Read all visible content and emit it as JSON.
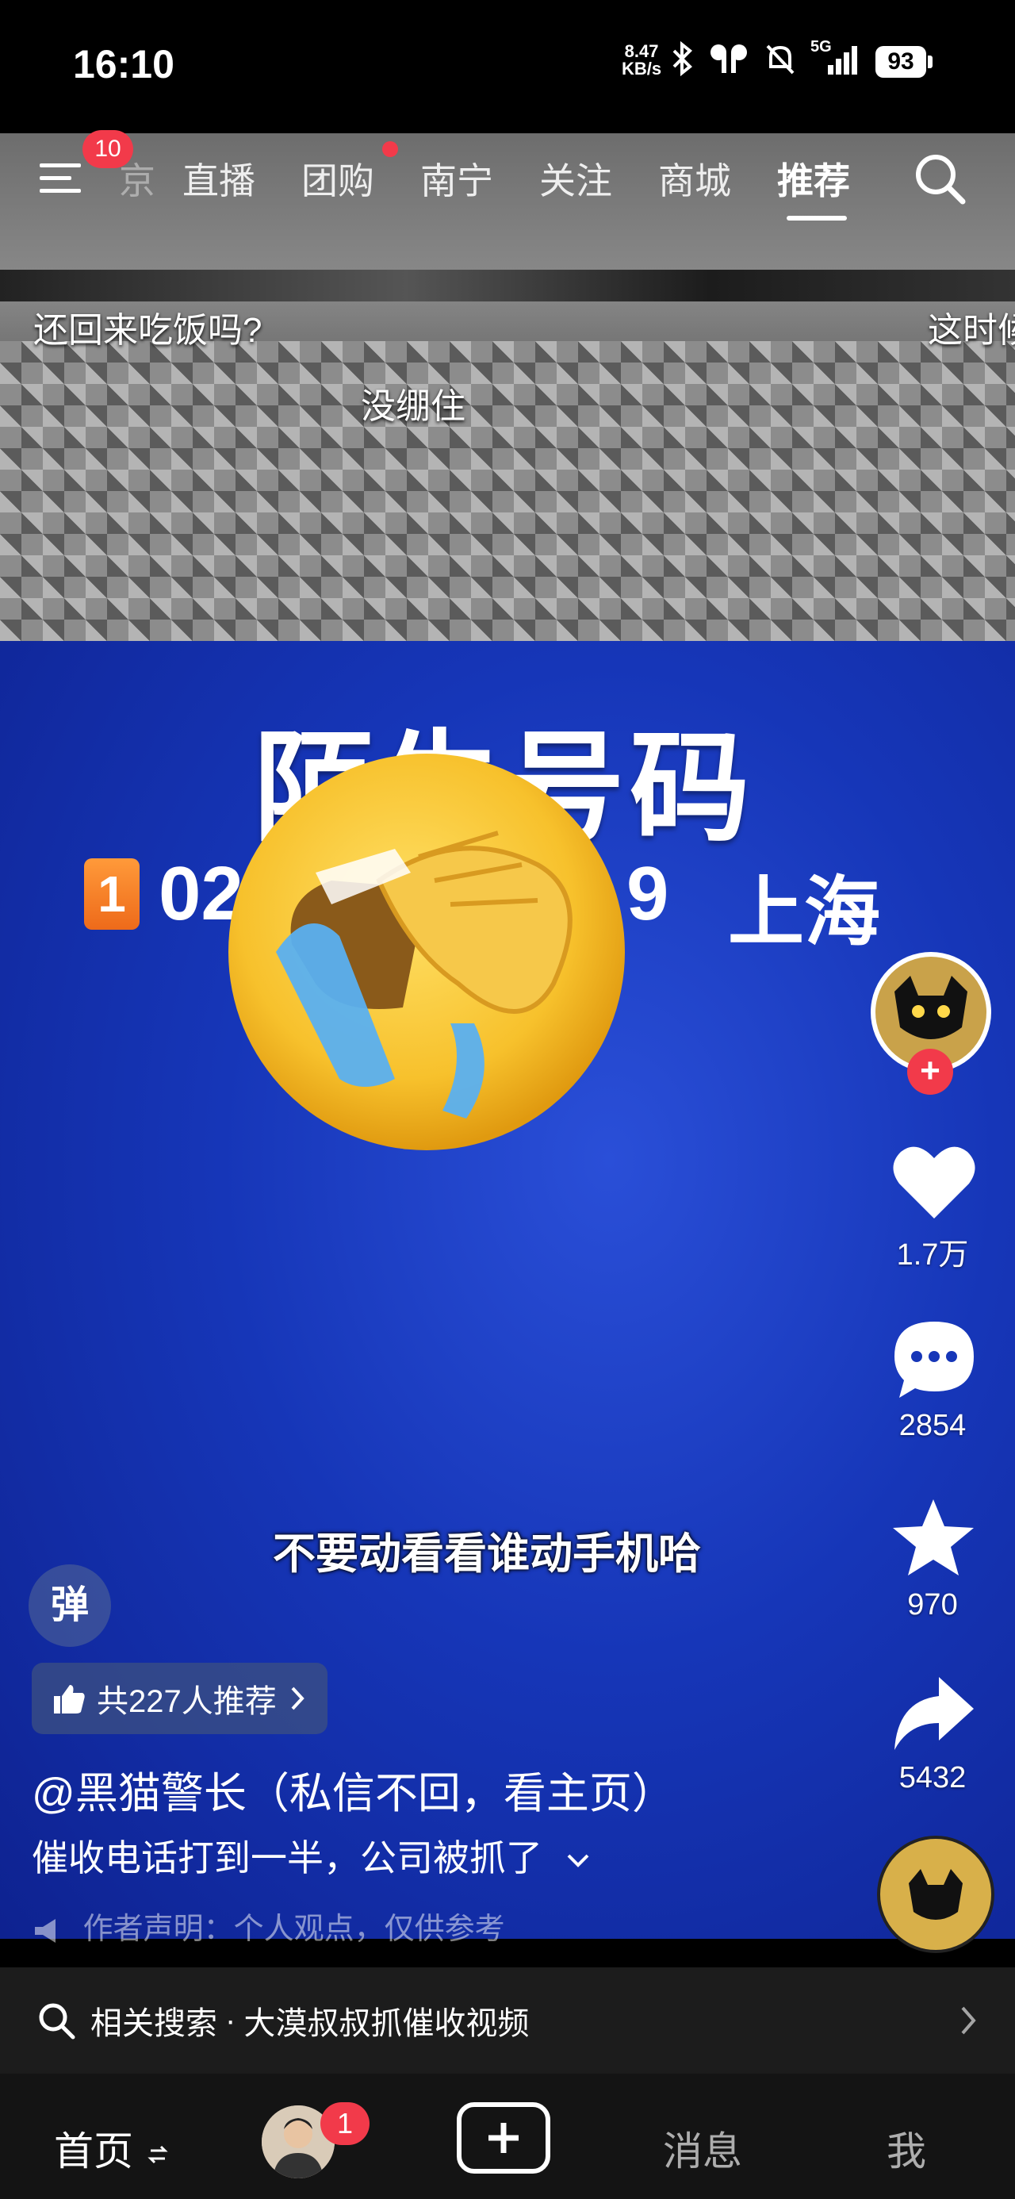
{
  "status_bar": {
    "time": "16:10",
    "speed_value": "8.47",
    "speed_unit": "KB/s",
    "network": "5G",
    "battery": "93",
    "icons": [
      "bluetooth-icon",
      "earbuds-icon",
      "mute-icon",
      "signal-icon"
    ]
  },
  "top_nav": {
    "menu_badge": "10",
    "tabs": [
      {
        "label": "京"
      },
      {
        "label": "直播"
      },
      {
        "label": "团购"
      },
      {
        "label": "南宁"
      },
      {
        "label": "关注"
      },
      {
        "label": "商城"
      },
      {
        "label": "推荐"
      }
    ],
    "active_tab": "推荐"
  },
  "video": {
    "caption_top_left": "还回来吃饭吗?",
    "caption_top_right": "这时候",
    "caption_mid": "没绷住",
    "big_title": "陌生号码",
    "number_index": "1",
    "number_prefix": "02",
    "number_suffix": "9",
    "location": "上海",
    "subtitle": "不要动看看谁动手机哈",
    "emoji": "face-palm-laughing-emoji"
  },
  "actions": {
    "like_count": "1.7万",
    "comment_count": "2854",
    "favorite_count": "970",
    "share_count": "5432"
  },
  "post": {
    "danmu_label": "弹",
    "recommend_text": "共227人推荐",
    "author": "@黑猫警长（私信不回，看主页）",
    "description": "催收电话打到一半，公司被抓了",
    "notice": "作者声明：个人观点，仅供参考"
  },
  "related_search": {
    "prefix": "相关搜索",
    "separator": "·",
    "query": "大漠叔叔抓催收视频"
  },
  "tab_bar": {
    "home": "首页",
    "friends_badge": "1",
    "messages": "消息",
    "me": "我"
  },
  "colors": {
    "badge_red": "#f23a4a",
    "video_blue": "#1636b8",
    "tab_bg": "#141414"
  }
}
